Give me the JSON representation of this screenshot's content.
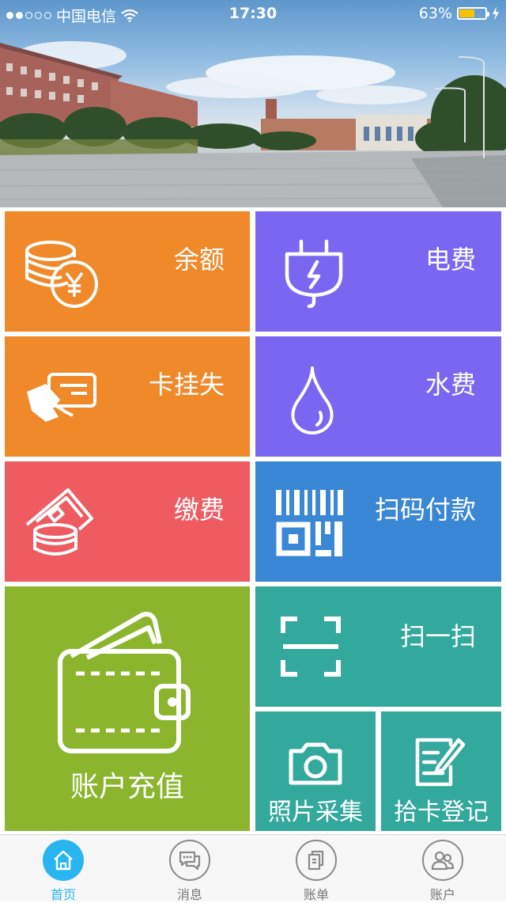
{
  "status_bar": {
    "carrier": "中国电信",
    "time": "17:30",
    "battery_percent": "63%",
    "battery_level": 0.63,
    "signal_bars_filled": 2,
    "signal_bars_total": 5
  },
  "tiles": {
    "balance": {
      "label": "余额",
      "color": "#f0892a"
    },
    "electricity": {
      "label": "电费",
      "color": "#7b66f2"
    },
    "card_loss": {
      "label": "卡挂失",
      "color": "#f0892a"
    },
    "water": {
      "label": "水费",
      "color": "#7b66f2"
    },
    "payment": {
      "label": "缴费",
      "color": "#ee5b61"
    },
    "scan_pay": {
      "label": "扫码付款",
      "color": "#3a87d6"
    },
    "recharge": {
      "label": "账户充值",
      "color": "#8bb52d"
    },
    "scan": {
      "label": "扫一扫",
      "color": "#33a89c"
    },
    "photo": {
      "label": "照片采集",
      "color": "#33a89c"
    },
    "found_card": {
      "label": "拾卡登记",
      "color": "#33a89c"
    }
  },
  "tabbar": {
    "items": [
      {
        "label": "首页",
        "icon": "home-icon",
        "active": true
      },
      {
        "label": "消息",
        "icon": "message-icon",
        "active": false
      },
      {
        "label": "账单",
        "icon": "bill-icon",
        "active": false
      },
      {
        "label": "账户",
        "icon": "account-icon",
        "active": false
      }
    ],
    "active_color": "#29b6f0"
  }
}
